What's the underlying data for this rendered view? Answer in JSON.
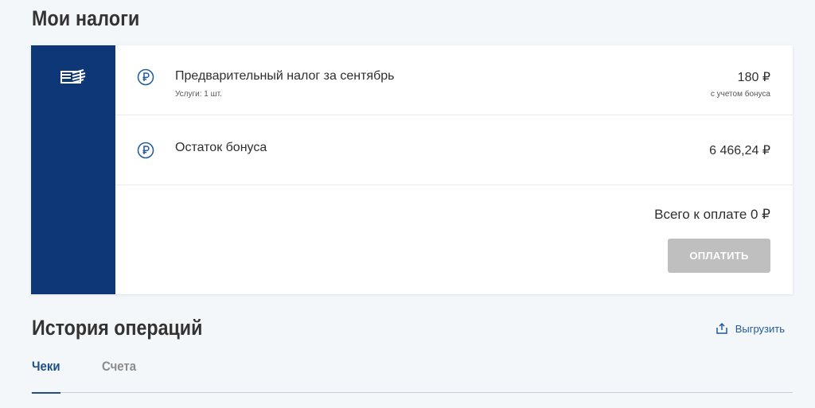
{
  "page": {
    "title": "Мои налоги"
  },
  "taxes": {
    "items": [
      {
        "icon": "ruble-icon",
        "title": "Предварительный налог за сентябрь",
        "subtitle": "Услуги: 1 шт.",
        "amount": "180 ₽",
        "amount_note": "с учетом бонуса"
      },
      {
        "icon": "ruble-icon",
        "title": "Остаток бонуса",
        "amount": "6 466,24 ₽"
      }
    ],
    "total_label": "Всего к оплате 0 ₽",
    "pay_button": "ОПЛАТИТЬ"
  },
  "history": {
    "title": "История операций",
    "export_label": "Выгрузить",
    "tabs": [
      {
        "label": "Чеки",
        "active": true
      },
      {
        "label": "Счета",
        "active": false
      }
    ]
  },
  "colors": {
    "sidebar_bg": "#0d3777",
    "accent": "#1f5a9b",
    "button_disabled": "#bfbfbf",
    "background": "#f3f7fa"
  }
}
